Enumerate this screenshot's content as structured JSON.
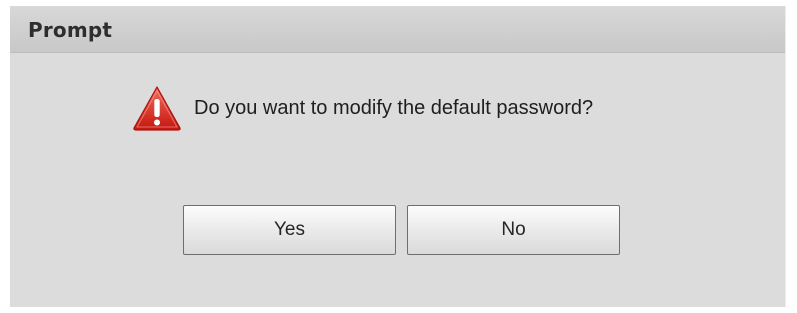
{
  "dialog": {
    "title": "Prompt",
    "message": "Do you want to modify the default password?",
    "icon": "warning-triangle-icon",
    "colors": {
      "icon_red": "#d9241c",
      "background": "#dcdcdc",
      "titlebar": "#cfcfcf"
    }
  },
  "buttons": {
    "yes_label": "Yes",
    "no_label": "No"
  }
}
